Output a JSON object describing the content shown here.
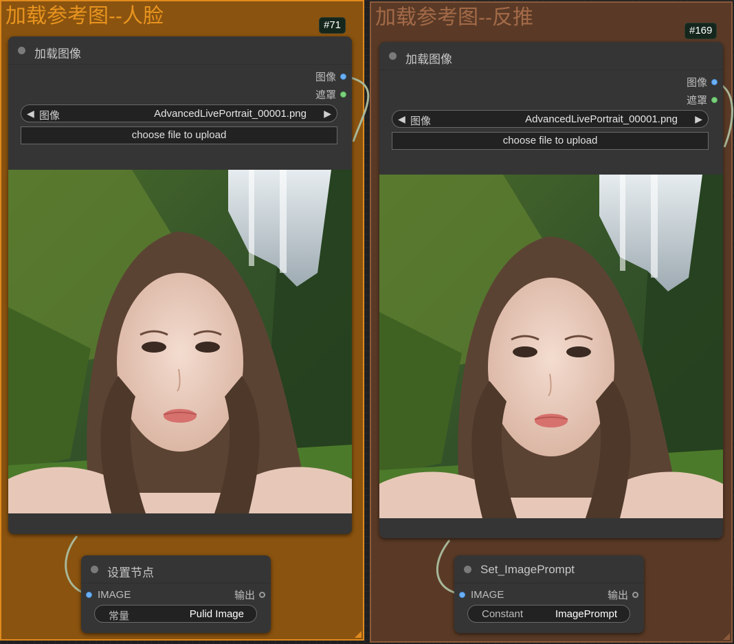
{
  "colors": {
    "canvas": "#202020",
    "group_left_fill": "#8a530f",
    "group_left_border": "#e08a1e",
    "group_left_title": "#e8941f",
    "group_right_fill": "#5a3a26",
    "group_right_border": "#8b5a3c",
    "group_right_title": "#a36a48",
    "node_body": "#353535",
    "image_slot": "#6ab0f8",
    "mask_slot": "#7ad07c",
    "link": "#a8b89a"
  },
  "groups": [
    {
      "title": "加载参考图--人脸",
      "load_node": {
        "badge": "#71",
        "title": "加载图像",
        "outputs": [
          {
            "label": "图像",
            "icon": "image-output-slot"
          },
          {
            "label": "遮罩",
            "icon": "mask-output-slot"
          }
        ],
        "combo": {
          "label": "图像",
          "value": "AdvancedLivePortrait_00001.png",
          "left_arrow": "◀",
          "right_arrow": "▶"
        },
        "upload_label": "choose file to upload",
        "preview_description": "portrait-photo"
      },
      "set_node": {
        "title": "设置节点",
        "input_label": "IMAGE",
        "output_label": "输出",
        "widget": {
          "label": "常量",
          "value": "Pulid Image"
        }
      }
    },
    {
      "title": "加载参考图--反推",
      "load_node": {
        "badge": "#169",
        "title": "加载图像",
        "outputs": [
          {
            "label": "图像",
            "icon": "image-output-slot"
          },
          {
            "label": "遮罩",
            "icon": "mask-output-slot"
          }
        ],
        "combo": {
          "label": "图像",
          "value": "AdvancedLivePortrait_00001.png",
          "left_arrow": "◀",
          "right_arrow": "▶"
        },
        "upload_label": "choose file to upload",
        "preview_description": "portrait-photo"
      },
      "set_node": {
        "title": "Set_ImagePrompt",
        "input_label": "IMAGE",
        "output_label": "输出",
        "widget": {
          "label": "Constant",
          "value": "ImagePrompt"
        }
      }
    }
  ]
}
